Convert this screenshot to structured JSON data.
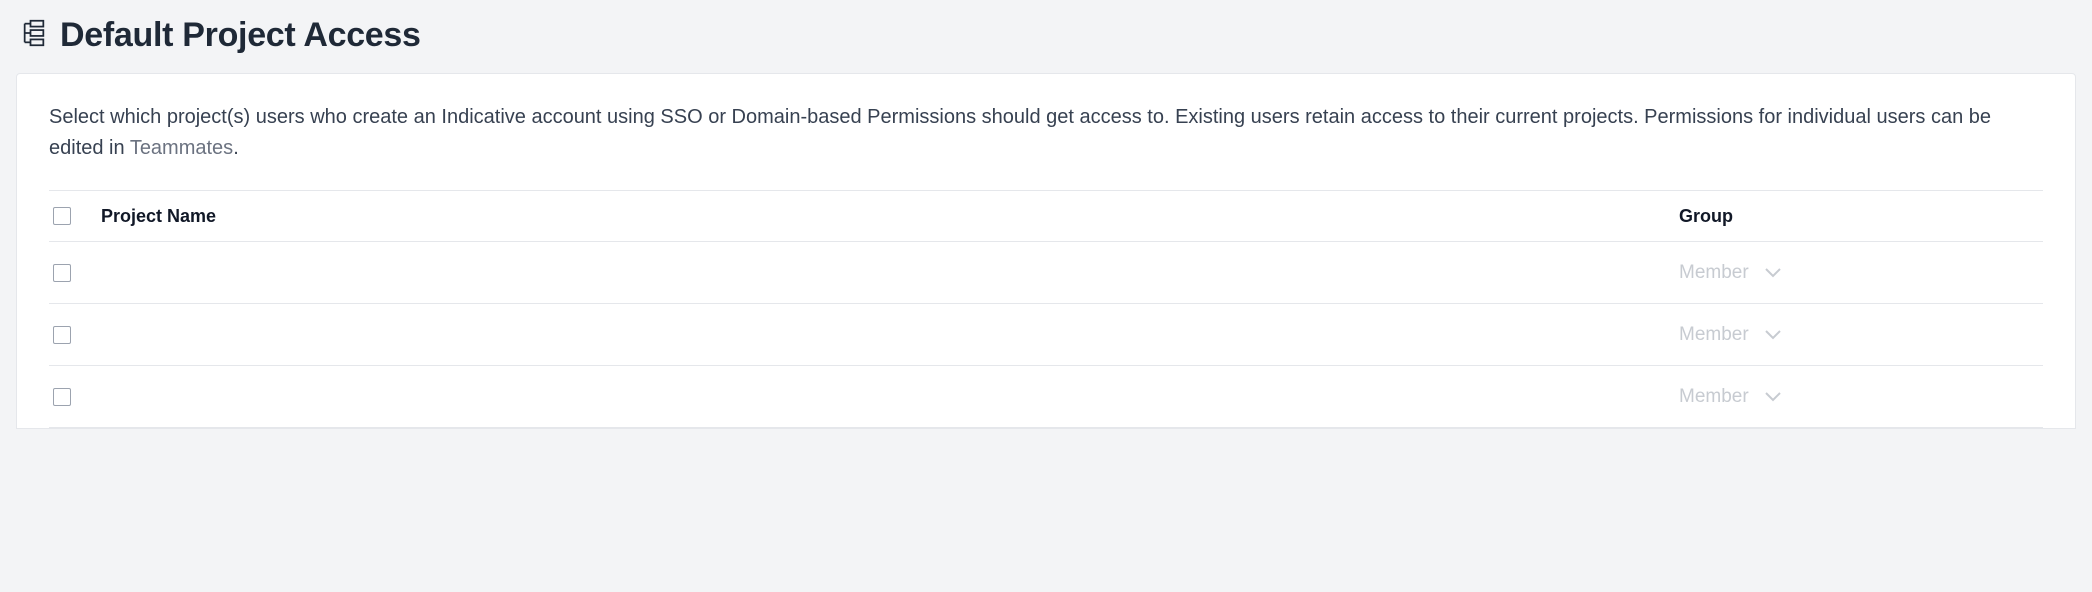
{
  "header": {
    "title": "Default Project Access"
  },
  "description": {
    "prefix": "Select which project(s) users who create an Indicative account using SSO or Domain-based Permissions should get access to. Existing users retain access to their current projects. Permissions for individual users can be edited in ",
    "link_text": "Teammates",
    "suffix": "."
  },
  "table": {
    "columns": {
      "name": "Project Name",
      "group": "Group"
    },
    "rows": [
      {
        "name": "",
        "group": "Member"
      },
      {
        "name": "",
        "group": "Member"
      },
      {
        "name": "",
        "group": "Member"
      }
    ]
  }
}
